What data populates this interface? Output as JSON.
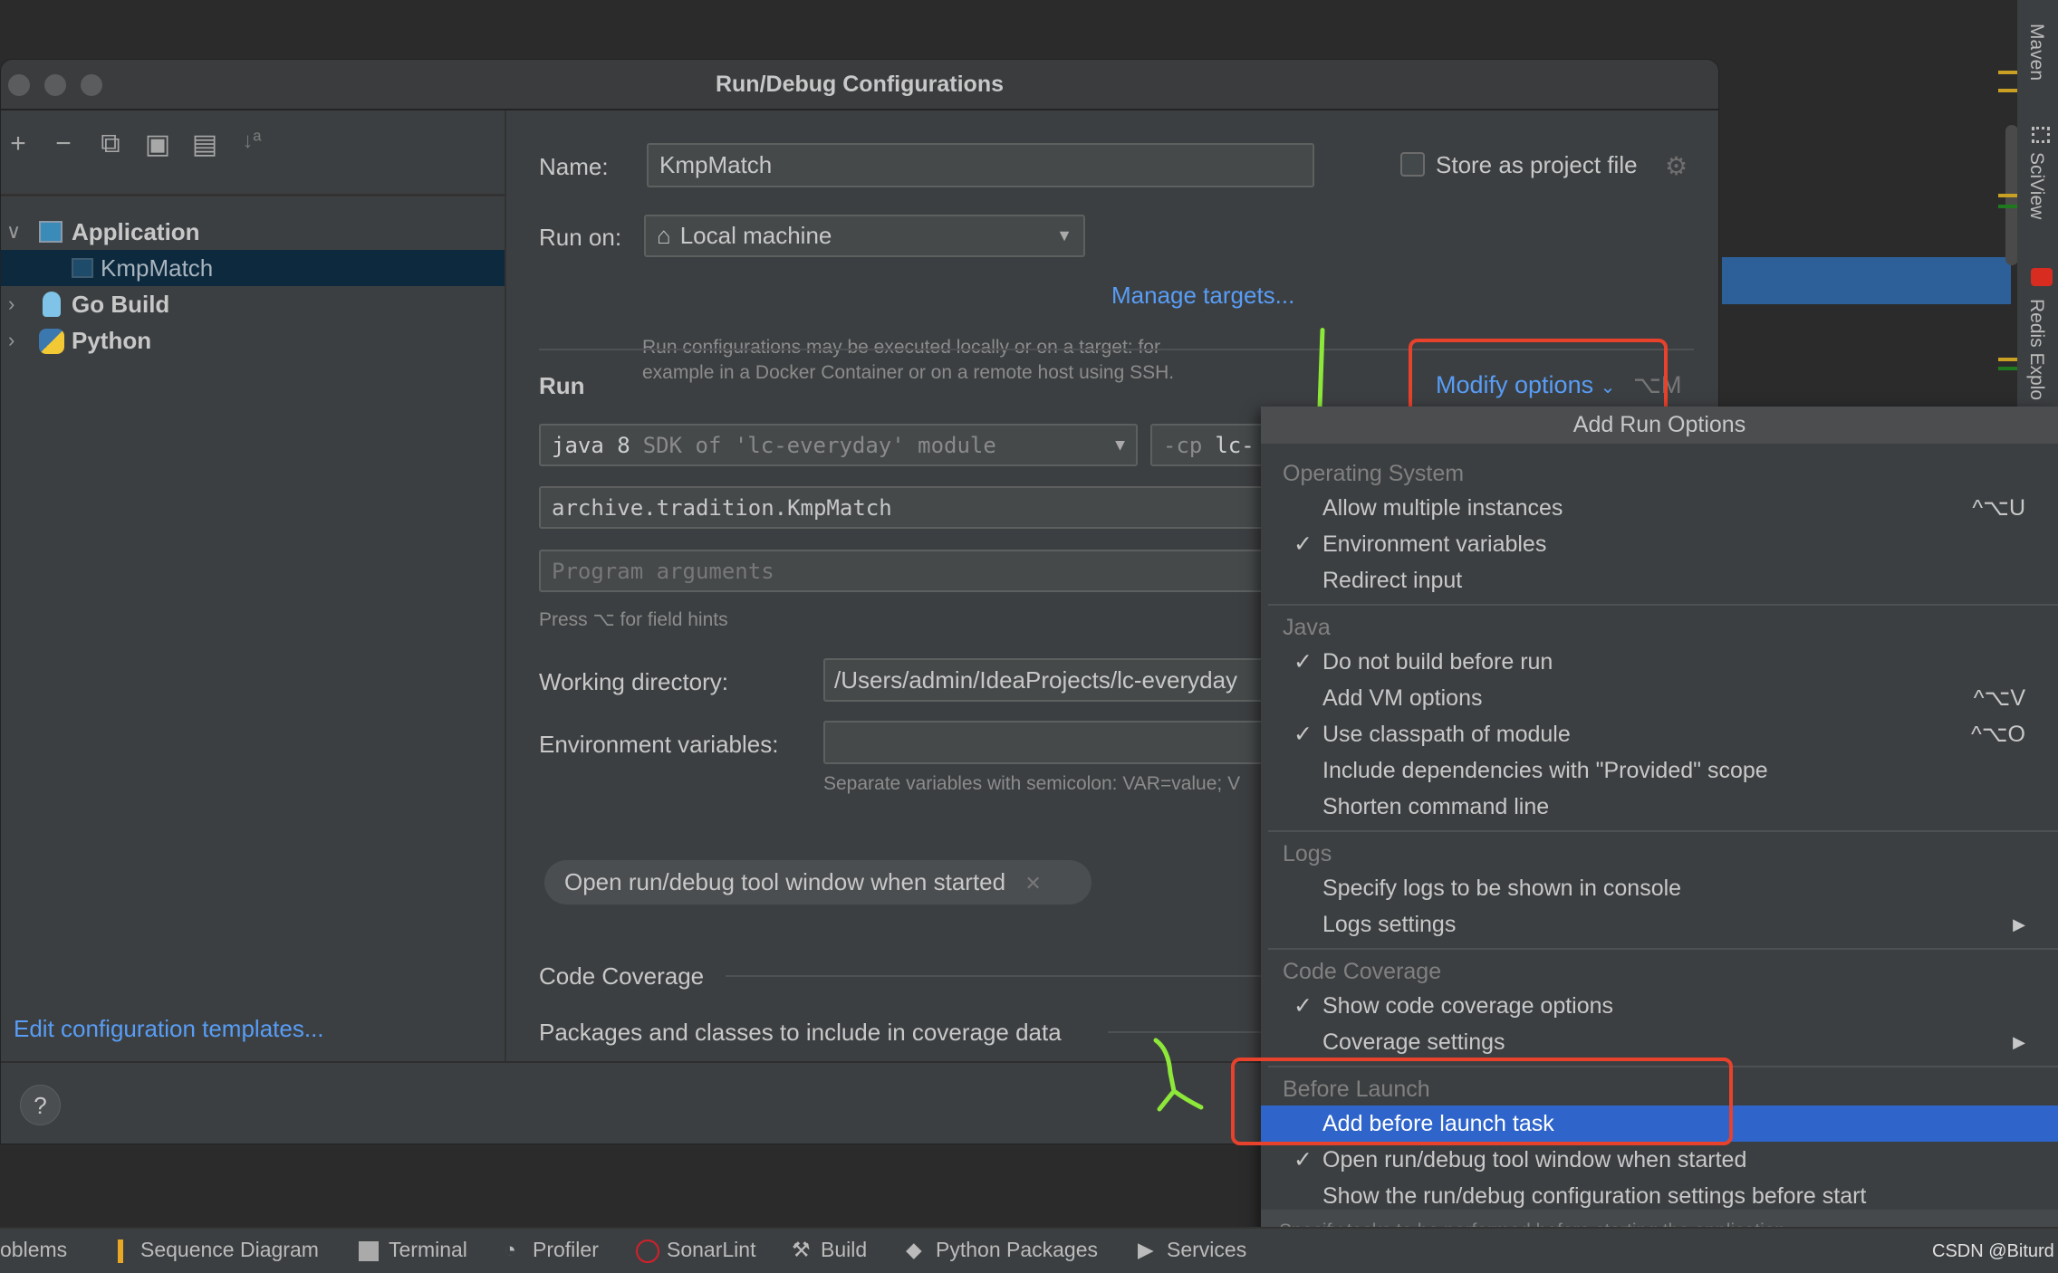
{
  "dialog": {
    "title": "Run/Debug Configurations"
  },
  "toolbar": {
    "add": "+",
    "remove": "−",
    "copy": "⧉",
    "save": "▣",
    "folder": "▤",
    "sort": "↓ª"
  },
  "tree": [
    {
      "label": "Application",
      "expanded": true
    },
    {
      "label": "KmpMatch",
      "selected": true
    },
    {
      "label": "Go Build"
    },
    {
      "label": "Python"
    }
  ],
  "edit_templates": "Edit configuration templates...",
  "help": "?",
  "form": {
    "name_label": "Name:",
    "name_value": "KmpMatch",
    "store_label": "Store as project file",
    "store_checked": false,
    "runon_label": "Run on:",
    "runon_value": "Local machine",
    "manage_targets": "Manage targets...",
    "runon_hint1": "Run configurations may be executed locally or on a target: for",
    "runon_hint2": "example in a Docker Container or on a remote host using SSH.",
    "run_section": "Run",
    "modify_options": "Modify options",
    "modify_shortcut": "⌥M",
    "jre_main": "java 8",
    "jre_sub": "SDK of 'lc-everyday' module",
    "cp_prefix": "-cp",
    "cp_value": "lc-",
    "main_class": "archive.tradition.KmpMatch",
    "program_args_placeholder": "Program arguments",
    "field_hint": "Press ⌥ for field hints",
    "workdir_label": "Working directory:",
    "workdir_value": "/Users/admin/IdeaProjects/lc-everyday",
    "env_label": "Environment variables:",
    "env_value": "",
    "env_hint": "Separate variables with semicolon: VAR=value; V",
    "chip": "Open run/debug tool window when started",
    "coverage_section": "Code Coverage",
    "packages_section": "Packages and classes to include in coverage data"
  },
  "popup": {
    "title": "Add Run Options",
    "footer": "Specify tasks to be performed before starting the application",
    "rows": [
      {
        "type": "cat",
        "label": "Operating System"
      },
      {
        "label": "Allow multiple instances",
        "shortcut": "^⌥U"
      },
      {
        "label": "Environment variables",
        "checked": true
      },
      {
        "label": "Redirect input"
      },
      {
        "type": "sep"
      },
      {
        "type": "cat",
        "label": "Java"
      },
      {
        "label": "Do not build before run",
        "checked": true
      },
      {
        "label": "Add VM options",
        "shortcut": "^⌥V"
      },
      {
        "label": "Use classpath of module",
        "checked": true,
        "shortcut": "^⌥O"
      },
      {
        "label": "Include dependencies with \"Provided\" scope"
      },
      {
        "label": "Shorten command line"
      },
      {
        "type": "sep"
      },
      {
        "type": "cat",
        "label": "Logs"
      },
      {
        "label": "Specify logs to be shown in console"
      },
      {
        "label": "Logs settings",
        "submenu": true
      },
      {
        "type": "sep"
      },
      {
        "type": "cat",
        "label": "Code Coverage"
      },
      {
        "label": "Show code coverage options",
        "checked": true
      },
      {
        "label": "Coverage settings",
        "submenu": true
      },
      {
        "type": "sep"
      },
      {
        "type": "cat",
        "label": "Before Launch"
      },
      {
        "label": "Add before launch task",
        "highlighted": true
      },
      {
        "label": "Open run/debug tool window when started",
        "checked": true
      },
      {
        "label": "Show the run/debug configuration settings before start"
      }
    ]
  },
  "statusbar": [
    "oblems",
    "Sequence Diagram",
    "Terminal",
    "Profiler",
    "SonarLint",
    "Build",
    "Python Packages",
    "Services"
  ],
  "watermark": "CSDN @Biturd",
  "right_tools": [
    "Maven",
    "SciView",
    "Redis Explo"
  ],
  "colors": {
    "accent": "#589df6",
    "highlight": "#2f65ca",
    "annotation_red": "#e8412c",
    "annotation_green": "#8de83a"
  }
}
